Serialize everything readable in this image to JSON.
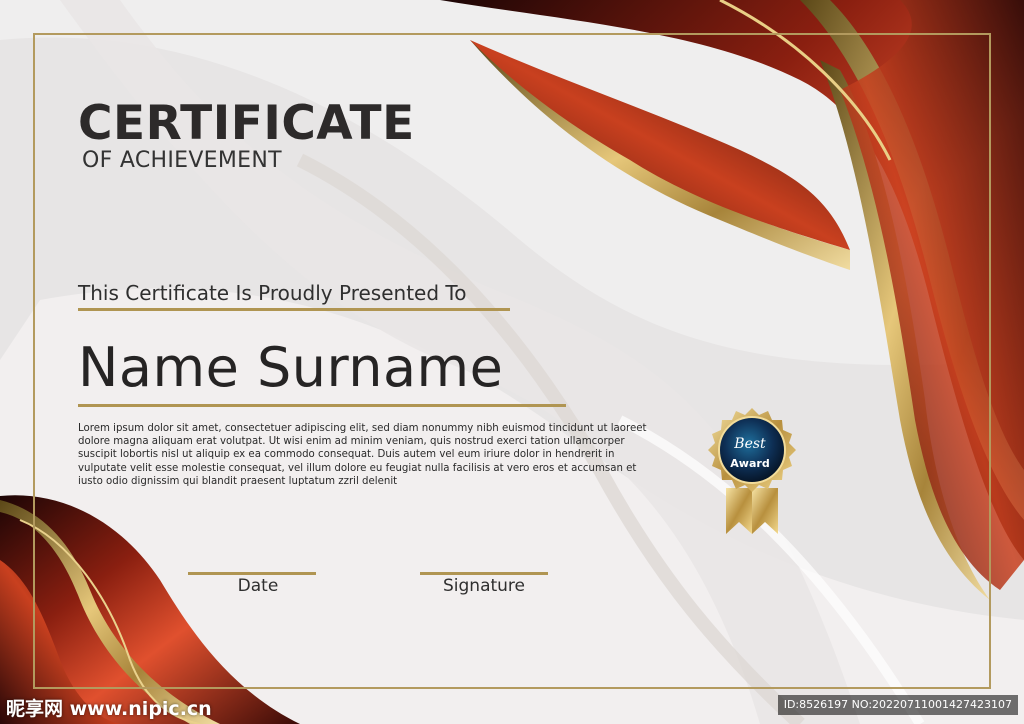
{
  "certificate": {
    "title": "CERTIFICATE",
    "subtitle": "OF ACHIEVEMENT",
    "presented_to": "This Certificate Is Proudly Presented To",
    "recipient_name": "Name Surname",
    "body": "Lorem ipsum dolor sit amet, consectetuer adipiscing elit, sed diam nonummy nibh euismod tincidunt ut laoreet dolore magna aliquam erat volutpat. Ut wisi enim ad minim veniam, quis nostrud exerci tation ullamcorper suscipit lobortis nisl ut aliquip ex ea commodo consequat. Duis autem vel eum iriure dolor in hendrerit in vulputate velit esse molestie consequat, vel illum dolore eu feugiat nulla facilisis at vero eros et accumsan et iusto odio dignissim qui blandit praesent luptatum zzril delenit",
    "date_label": "Date",
    "signature_label": "Signature"
  },
  "badge": {
    "line1": "Best",
    "line2": "Award"
  },
  "watermark": {
    "site": "昵享网 www.nipic.cn",
    "id": "ID:8526197 NO:20220711001427423107"
  },
  "colors": {
    "accent_gold": "#b09552",
    "accent_red": "#d8472a",
    "dark_maroon": "#2a0808",
    "text_dark": "#2d2a2a",
    "badge_navy": "#0d2a4a"
  }
}
